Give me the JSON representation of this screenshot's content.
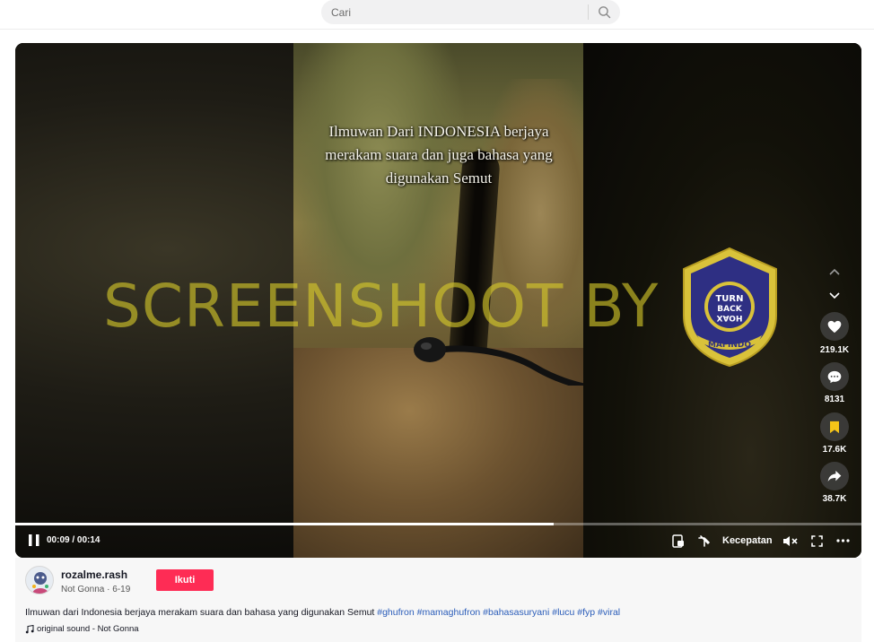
{
  "search": {
    "placeholder": "Cari"
  },
  "video": {
    "subtitle": "Ilmuwan Dari INDONESIA berjaya merakam suara dan juga bahasa yang digunakan Semut",
    "watermark": "SCREENSHOOT BY",
    "badge": {
      "ring_text_top": "MASYARAKAT ANTI FITNAH INDONESIA",
      "center_line1": "TURN",
      "center_line2": "BACK",
      "center_line3": "HOAX",
      "bottom": "MAFINDO",
      "color_blue": "#2e2f83",
      "color_gold": "#d9c23a"
    },
    "progress": 0.636,
    "time": "00:09 / 00:14",
    "speed_label": "Kecepatan"
  },
  "actions": {
    "likes": "219.1K",
    "comments": "8131",
    "saves": "17.6K",
    "shares": "38.7K"
  },
  "author": {
    "username": "rozalme.rash",
    "sub": "Not Gonna · 6-19",
    "follow_label": "Ikuti"
  },
  "caption": {
    "text": "Ilmuwan dari Indonesia berjaya merakam suara dan bahasa yang digunakan Semut",
    "tags": [
      "#ghufron",
      "#mamaghufron",
      "#bahasasuryani",
      "#lucu",
      "#fyp",
      "#viral"
    ]
  },
  "sound": {
    "label": "original sound - Not Gonna"
  },
  "colors": {
    "accent": "#fe2c55",
    "tag": "#2b5db9"
  }
}
